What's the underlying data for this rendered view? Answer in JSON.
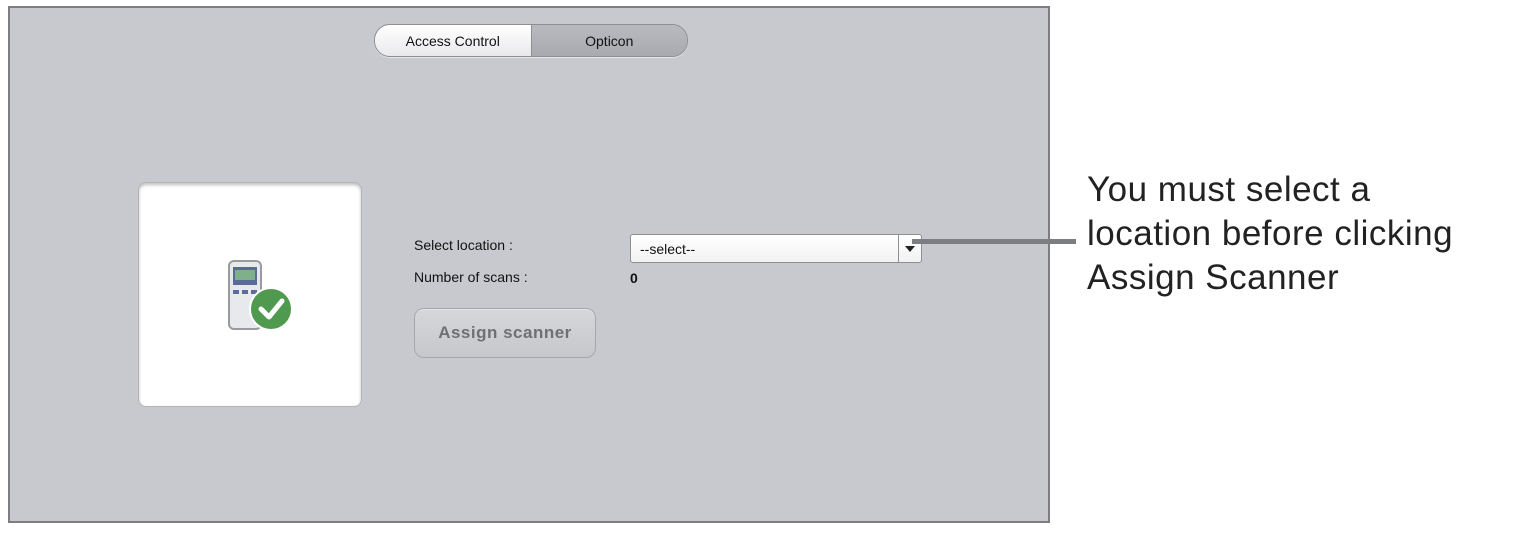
{
  "tabs": [
    {
      "label": "Access Control",
      "selected": false
    },
    {
      "label": "Opticon",
      "selected": true
    }
  ],
  "form": {
    "location_label": "Select location :",
    "location_value": "--select--",
    "scans_label": "Number of scans :",
    "scans_value": "0",
    "assign_button": "Assign scanner"
  },
  "callout": {
    "lines": [
      "You must select a",
      "location before clicking",
      "Assign Scanner"
    ]
  },
  "icons": {
    "device": "scanner-device-icon",
    "status": "checkmark-icon",
    "dropdown": "chevron-down-icon"
  },
  "colors": {
    "panel": "#c8c9ce",
    "check": "#4f9a4f"
  }
}
